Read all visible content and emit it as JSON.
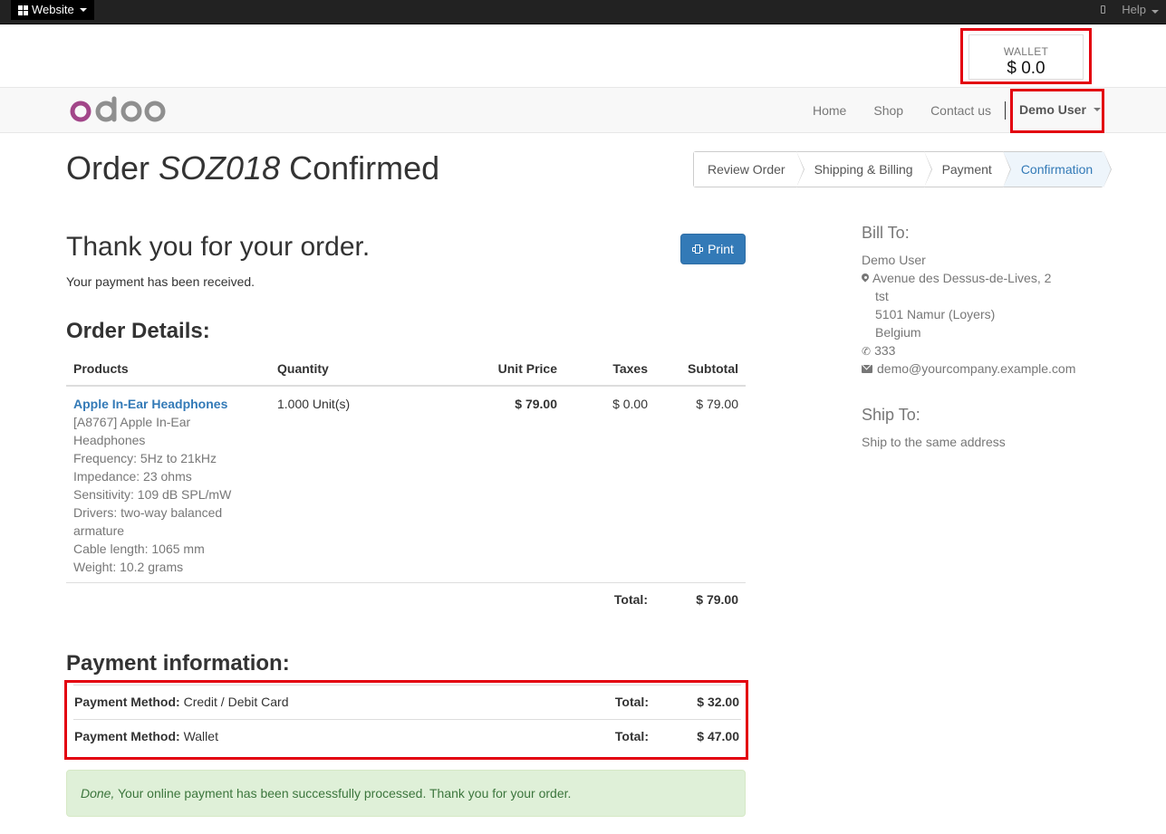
{
  "topbar": {
    "website_label": "Website",
    "help_label": "Help"
  },
  "wallet": {
    "label": "WALLET",
    "value": "$ 0.0"
  },
  "navbar": {
    "logo_text": "odoo",
    "links": [
      "Home",
      "Shop",
      "Contact us"
    ],
    "user_label": "Demo User"
  },
  "page": {
    "title_prefix": "Order ",
    "order_ref": "SOZ018",
    "title_suffix": " Confirmed"
  },
  "wizard": {
    "steps": [
      "Review Order",
      "Shipping & Billing",
      "Payment",
      "Confirmation"
    ],
    "active": "Confirmation"
  },
  "thanks": {
    "heading": "Thank you for your order.",
    "message": "Your payment has been received.",
    "print_label": "Print"
  },
  "order": {
    "heading": "Order Details:",
    "columns": [
      "Products",
      "Quantity",
      "Unit Price",
      "Taxes",
      "Subtotal"
    ],
    "items": [
      {
        "name": "Apple In-Ear Headphones",
        "description": [
          "[A8767] Apple In-Ear",
          "Headphones",
          "Frequency: 5Hz to 21kHz",
          "Impedance: 23 ohms",
          "Sensitivity: 109 dB SPL/mW",
          "Drivers: two-way balanced",
          "armature",
          "Cable length: 1065 mm",
          "Weight: 10.2 grams"
        ],
        "quantity": "1.000 Unit(s)",
        "unit_price": "$ 79.00",
        "taxes": "$ 0.00",
        "subtotal": "$ 79.00"
      }
    ],
    "total_label": "Total:",
    "total_value": "$ 79.00"
  },
  "payment": {
    "heading": "Payment information:",
    "rows": [
      {
        "method_label": "Payment Method:",
        "method": " Credit / Debit Card",
        "total_label": "Total:",
        "total": "$ 32.00"
      },
      {
        "method_label": "Payment Method:",
        "method": " Wallet",
        "total_label": "Total:",
        "total": "$ 47.00"
      }
    ]
  },
  "alert": {
    "emphasis": "Done,",
    "message": " Your online payment has been successfully processed. Thank you for your order."
  },
  "bill_to": {
    "heading": "Bill To:",
    "name": "Demo User",
    "street": "Avenue des Dessus-de-Lives, 2",
    "street2": "tst",
    "city": "5101 Namur (Loyers)",
    "country": "Belgium",
    "phone": "333",
    "email": "demo@yourcompany.example.com"
  },
  "ship_to": {
    "heading": "Ship To:",
    "text": "Ship to the same address"
  },
  "colors": {
    "primary": "#337ab7",
    "highlight": "#e3000f",
    "success_bg": "#dff0d8",
    "success_text": "#3c763d",
    "logo_purple": "#a24689",
    "logo_grey": "#8f8f8f"
  }
}
